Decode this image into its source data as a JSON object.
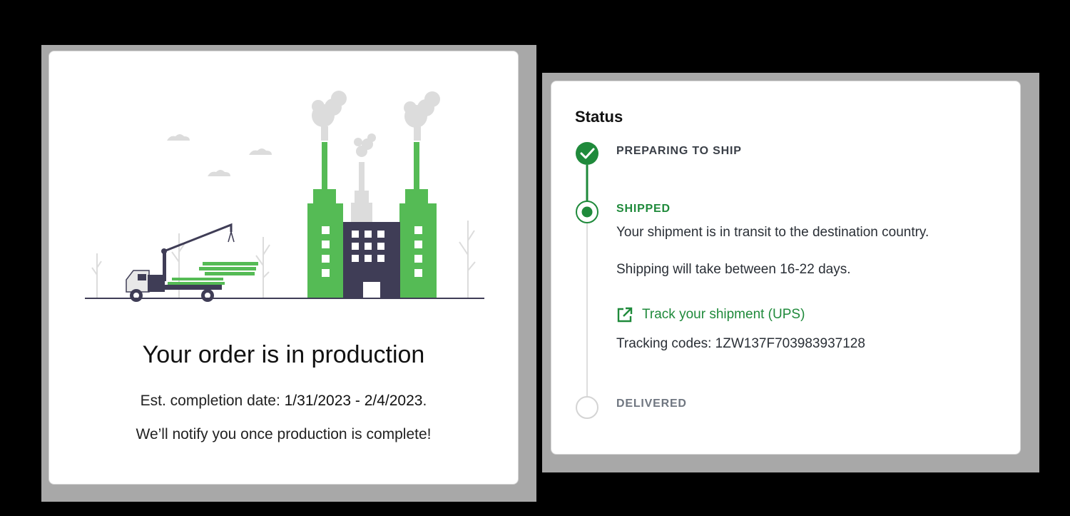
{
  "production_card": {
    "title": "Your order is in production",
    "completion_prefix": "Est. completion date: ",
    "completion_dates": "1/31/2023 - 2/4/2023",
    "completion_suffix": ".",
    "notify_text": "We’ll notify you once production is complete!"
  },
  "status_card": {
    "title": "Status",
    "steps": [
      {
        "label": "PREPARING TO SHIP",
        "state": "done"
      },
      {
        "label": "SHIPPED",
        "state": "active"
      },
      {
        "label": "DELIVERED",
        "state": "pending"
      }
    ],
    "shipped_detail": {
      "transit_text": "Your shipment is in transit to the destination country.",
      "duration_text": "Shipping will take between 16-22 days.",
      "track_link_label": "Track your shipment (UPS)",
      "track_icon": "external-link-icon",
      "tracking_codes_label": "Tracking codes: 1ZW137F703983937128"
    }
  },
  "colors": {
    "accent_green": "#1f8a3b",
    "factory_green": "#55bb55",
    "building_dark": "#3f3d56",
    "smoke_gray": "#d8d8d8"
  }
}
